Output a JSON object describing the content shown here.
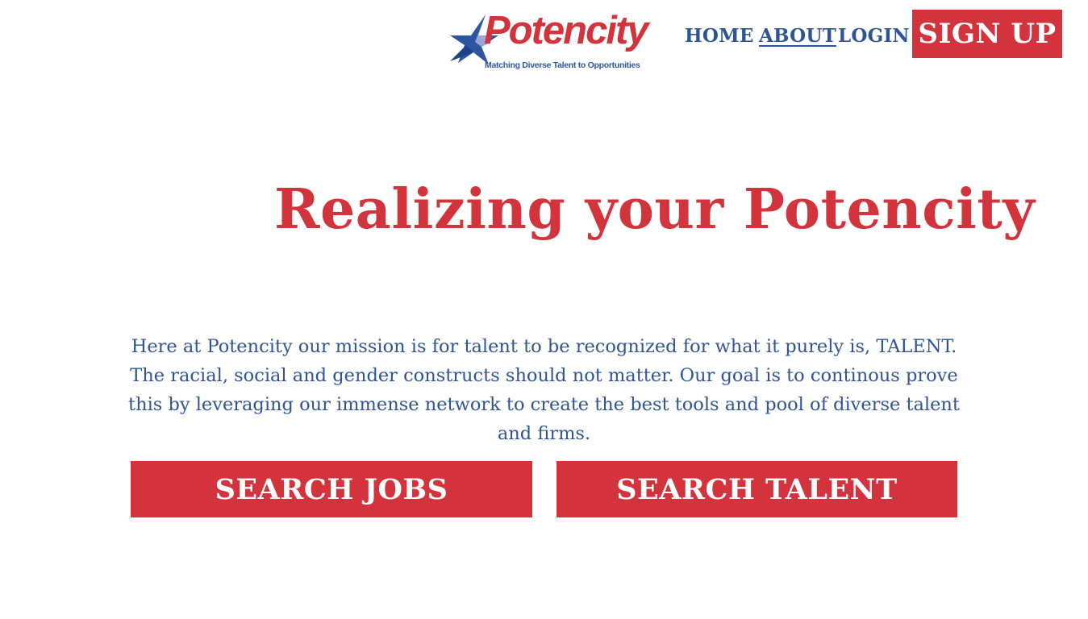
{
  "header": {
    "logo": {
      "wordmark": "Potencity",
      "tagline": "Matching Diverse Talent to Opportunities",
      "icon": "star-icon"
    },
    "nav": [
      {
        "label": "HOME",
        "active": false
      },
      {
        "label": "ABOUT",
        "active": true
      },
      {
        "label": "LOGIN",
        "active": false
      }
    ],
    "signup_label": "SIGN UP"
  },
  "hero": {
    "title": "Realizing your Potencity",
    "mission": "Here at Potencity our mission is for talent to be recognized for what it purely is, TALENT. The racial, social and gender constructs should not matter. Our goal is to continous prove this by leveraging our immense network to create the best tools and pool of diverse talent and firms."
  },
  "actions": {
    "search_jobs_label": "SEARCH JOBS",
    "search_talent_label": "SEARCH TALENT"
  },
  "colors": {
    "brand_red": "#d3333d",
    "brand_blue": "#2f5496",
    "background": "#ffffff"
  }
}
